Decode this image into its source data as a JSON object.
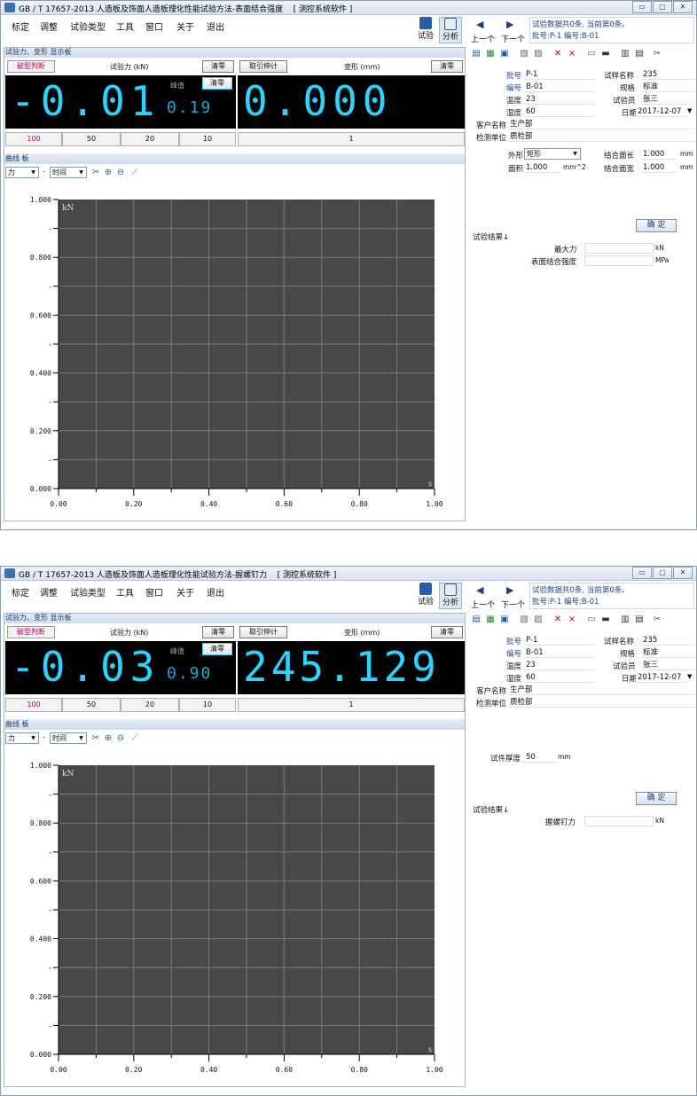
{
  "windows": [
    {
      "title": "GB / T 17657-2013 人造板及饰面人造板理化性能试验方法-表面结合强度",
      "title_suffix": "[ 测控系统软件 ]",
      "menu": [
        "标定",
        "调整",
        "试验类型",
        "工具",
        "窗口",
        "关于",
        "退出"
      ],
      "mode_buttons": [
        "试验",
        "分析"
      ],
      "panel_title": "试验力、变形 显示板",
      "break_btn": "破型判断",
      "force_label": "试验力 (kN)",
      "clear_btn": "清零",
      "extensometer_btn": "取引伸计",
      "deform_label": "变形 (mm)",
      "peak_label": "峰值",
      "force_value": "-0.01",
      "peak_value": "0.19",
      "deform_value": "0.000",
      "scales": [
        "100",
        "50",
        "20",
        "10"
      ],
      "deform_scale": "1",
      "curve_title": "曲线 板",
      "x_select": "力",
      "y_select": "时间",
      "dash": "-",
      "nav": {
        "prev": "上一个",
        "next": "下一个",
        "prev_icon": "◀",
        "next_icon": "▶"
      },
      "info_line1": "试验数据共0条, 当前第0条。",
      "info_line2": "批号:P-1 编号:B-01",
      "fields": {
        "batch_label": "批号",
        "batch": "P-1",
        "code_label": "编号",
        "code": "B-01",
        "temp_label": "温度",
        "temp": "23",
        "humid_label": "湿度",
        "humid": "60",
        "sample_label": "试样名称",
        "sample": "235",
        "spec_label": "规格",
        "spec": "标准",
        "tester_label": "试验员",
        "tester": "张三",
        "date_label": "日期",
        "date": "2017-12-07",
        "client_label": "客户名称",
        "client": "生产部",
        "inspector_label": "检测单位",
        "inspector": "质检部"
      },
      "shape_label": "外形",
      "shape": "矩形",
      "area_label": "面积",
      "area": "1.000",
      "area_unit": "mm^2",
      "bond_len_label": "结合面长",
      "bond_len": "1.000",
      "bond_len_unit": "mm",
      "bond_wid_label": "结合面宽",
      "bond_wid": "1.000",
      "bond_wid_unit": "mm",
      "ok_btn": "确 定",
      "result_title": "试验结果↓",
      "results": [
        {
          "label": "最大力",
          "value": "",
          "unit": "kN"
        },
        {
          "label": "表面结合强度",
          "value": "",
          "unit": "MPa"
        }
      ],
      "chart": {
        "y_unit": "kN",
        "x_unit": "s",
        "y_ticks": [
          "1.000",
          "0.800",
          "0.600",
          "0.400",
          "0.200",
          "0.000"
        ],
        "x_ticks": [
          "0.00",
          "0.20",
          "0.40",
          "0.60",
          "0.80",
          "1.00"
        ]
      }
    },
    {
      "title": "GB / T 17657-2013 人造板及饰面人造板理化性能试验方法-握螺钉力",
      "title_suffix": "[ 测控系统软件 ]",
      "menu": [
        "标定",
        "调整",
        "试验类型",
        "工具",
        "窗口",
        "关于",
        "退出"
      ],
      "mode_buttons": [
        "试验",
        "分析"
      ],
      "panel_title": "试验力、变形 显示板",
      "break_btn": "破型判断",
      "force_label": "试验力 (kN)",
      "clear_btn": "清零",
      "extensometer_btn": "取引伸计",
      "deform_label": "变形 (mm)",
      "peak_label": "峰值",
      "force_value": "-0.03",
      "peak_value": "0.90",
      "deform_value": "245.129",
      "scales": [
        "100",
        "50",
        "20",
        "10"
      ],
      "deform_scale": "1",
      "curve_title": "曲线 板",
      "x_select": "力",
      "y_select": "时间",
      "dash": "-",
      "nav": {
        "prev": "上一个",
        "next": "下一个",
        "prev_icon": "◀",
        "next_icon": "▶"
      },
      "info_line1": "试验数据共0条, 当前第0条。",
      "info_line2": "批号:P-1 编号:B-01",
      "fields": {
        "batch_label": "批号",
        "batch": "P-1",
        "code_label": "编号",
        "code": "B-01",
        "temp_label": "温度",
        "temp": "23",
        "humid_label": "湿度",
        "humid": "60",
        "sample_label": "试样名称",
        "sample": "235",
        "spec_label": "规格",
        "spec": "标准",
        "tester_label": "试验员",
        "tester": "张三",
        "date_label": "日期",
        "date": "2017-12-07",
        "client_label": "客户名称",
        "client": "生产部",
        "inspector_label": "检测单位",
        "inspector": "质检部"
      },
      "thickness_label": "试件厚度",
      "thickness": "50",
      "thickness_unit": "mm",
      "ok_btn": "确 定",
      "result_title": "试验结果↓",
      "results": [
        {
          "label": "握螺钉力",
          "value": "",
          "unit": "kN"
        }
      ],
      "chart": {
        "y_unit": "kN",
        "x_unit": "s",
        "y_ticks": [
          "1.000",
          "0.800",
          "0.600",
          "0.400",
          "0.200",
          "0.000"
        ],
        "x_ticks": [
          "0.00",
          "0.20",
          "0.40",
          "0.60",
          "0.80",
          "1.00"
        ]
      }
    }
  ]
}
